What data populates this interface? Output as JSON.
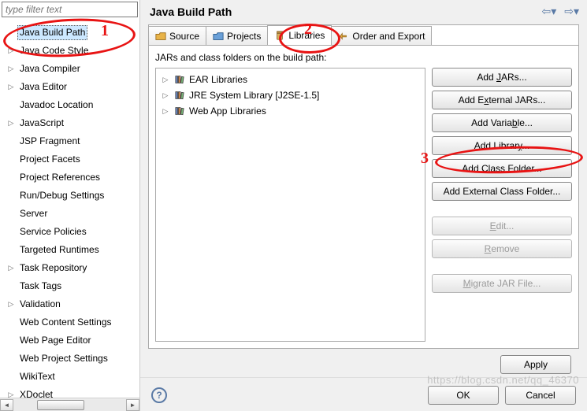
{
  "filter": {
    "placeholder": "type filter text"
  },
  "sidebar": {
    "items": [
      {
        "label": "Java Build Path",
        "expandable": false,
        "selected": true
      },
      {
        "label": "Java Code Style",
        "expandable": true
      },
      {
        "label": "Java Compiler",
        "expandable": true
      },
      {
        "label": "Java Editor",
        "expandable": true
      },
      {
        "label": "Javadoc Location",
        "expandable": false
      },
      {
        "label": "JavaScript",
        "expandable": true
      },
      {
        "label": "JSP Fragment",
        "expandable": false
      },
      {
        "label": "Project Facets",
        "expandable": false
      },
      {
        "label": "Project References",
        "expandable": false
      },
      {
        "label": "Run/Debug Settings",
        "expandable": false
      },
      {
        "label": "Server",
        "expandable": false
      },
      {
        "label": "Service Policies",
        "expandable": false
      },
      {
        "label": "Targeted Runtimes",
        "expandable": false
      },
      {
        "label": "Task Repository",
        "expandable": true
      },
      {
        "label": "Task Tags",
        "expandable": false
      },
      {
        "label": "Validation",
        "expandable": true
      },
      {
        "label": "Web Content Settings",
        "expandable": false
      },
      {
        "label": "Web Page Editor",
        "expandable": false
      },
      {
        "label": "Web Project Settings",
        "expandable": false
      },
      {
        "label": "WikiText",
        "expandable": false
      },
      {
        "label": "XDoclet",
        "expandable": true
      }
    ]
  },
  "page": {
    "title": "Java Build Path"
  },
  "tabs": {
    "items": [
      {
        "label": "Source",
        "icon": "folder-orange"
      },
      {
        "label": "Projects",
        "icon": "folder-blue"
      },
      {
        "label": "Libraries",
        "icon": "jar",
        "active": true
      },
      {
        "label": "Order and Export",
        "icon": "order"
      }
    ]
  },
  "libraries": {
    "hint": "JARs and class folders on the build path:",
    "items": [
      {
        "label": "EAR Libraries"
      },
      {
        "label": "JRE System Library [J2SE-1.5]"
      },
      {
        "label": "Web App Libraries"
      }
    ]
  },
  "buttons": {
    "addJars": "Add JARs...",
    "addExternalJars": "Add External JARs...",
    "addVariable": "Add Variable...",
    "addLibrary": "Add Library...",
    "addClassFolder": "Add Class Folder...",
    "addExternalClassFolder": "Add External Class Folder...",
    "edit": "Edit...",
    "remove": "Remove",
    "migrate": "Migrate JAR File...",
    "apply": "Apply",
    "ok": "OK",
    "cancel": "Cancel"
  },
  "annotations": {
    "num1": "1",
    "num2": "2",
    "num3": "3"
  },
  "watermark": "https://blog.csdn.net/qq_46370"
}
